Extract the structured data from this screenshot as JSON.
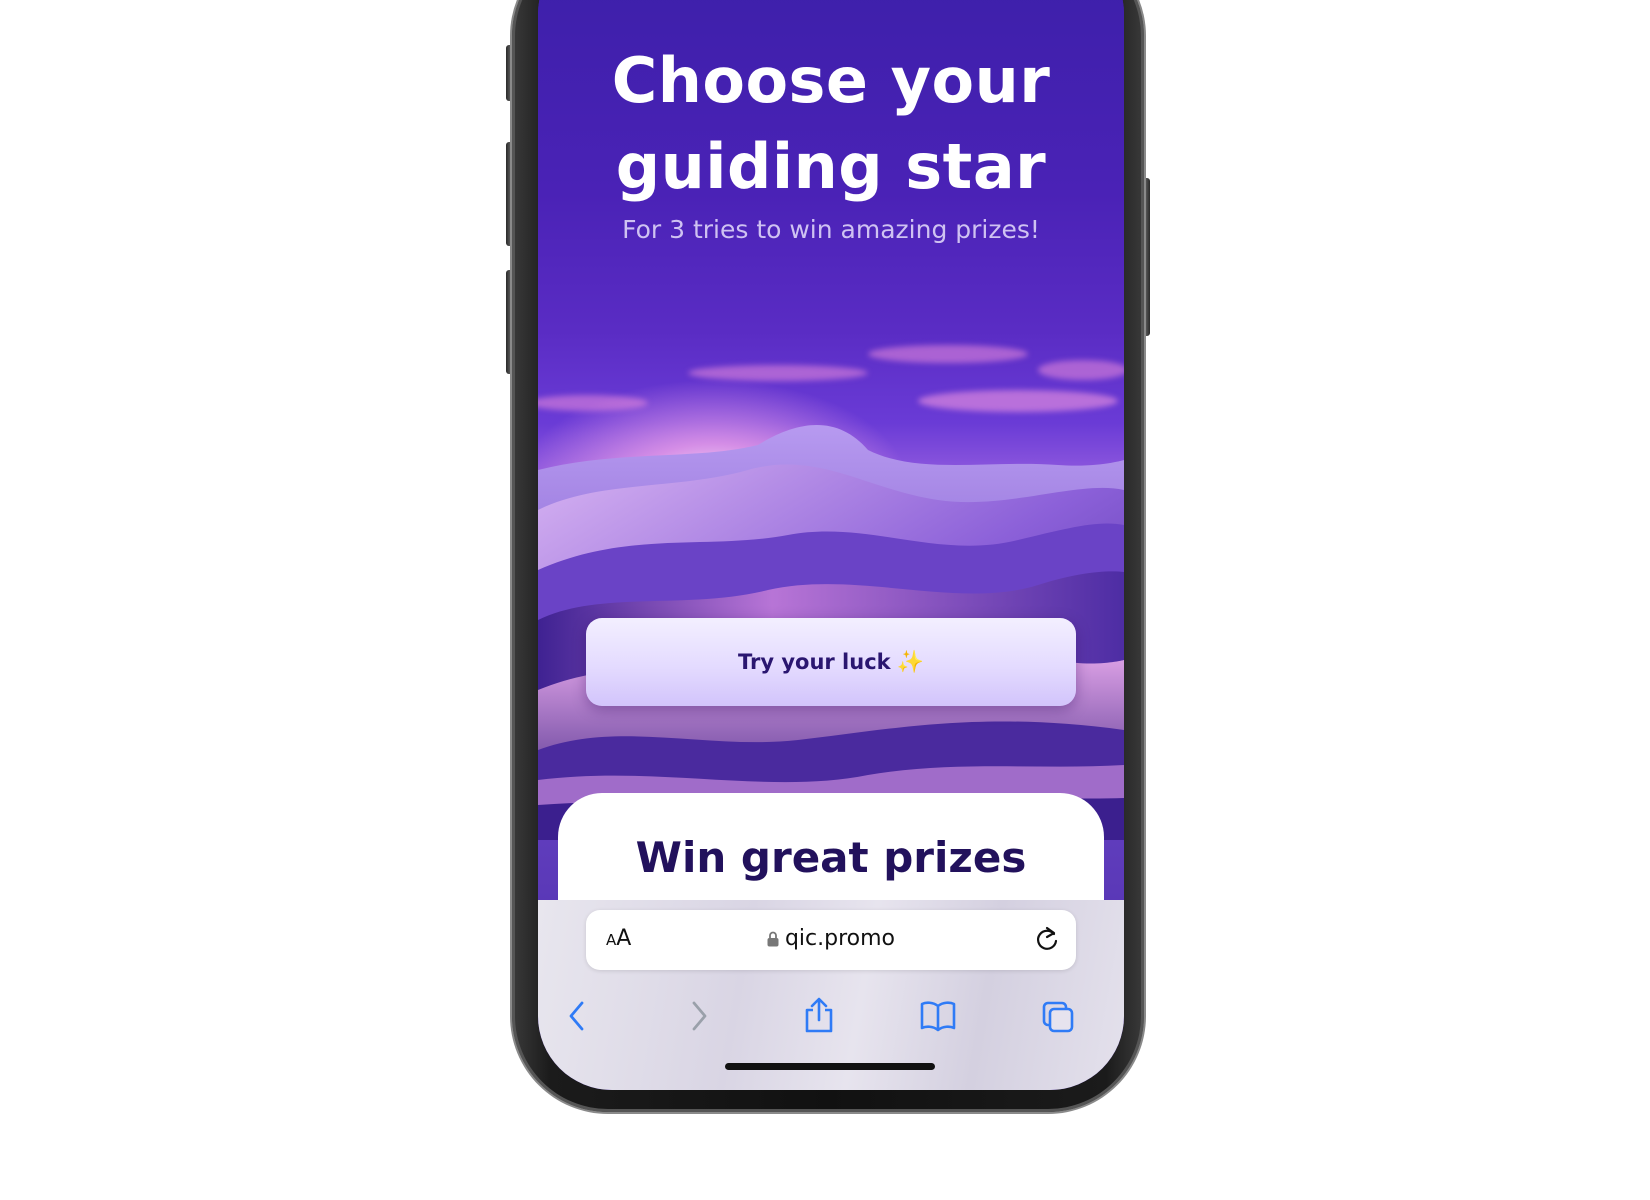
{
  "hero": {
    "title": "Choose your\nguiding star",
    "subtitle": "For 3 tries to win amazing prizes!"
  },
  "cta": {
    "label": "Try your luck",
    "emoji": "✨"
  },
  "card": {
    "title": "Win great prizes"
  },
  "browser": {
    "text_size_label_small": "A",
    "text_size_label_large": "A",
    "url": "qic.promo",
    "icons": [
      "lock-icon",
      "reload-icon",
      "back-icon",
      "forward-icon",
      "share-icon",
      "bookmarks-icon",
      "tabs-icon"
    ]
  },
  "colors": {
    "accent": "#2f7bf6",
    "forward_disabled": "#9aa0aa",
    "card_title": "#22115c",
    "cta_text": "#2a1670"
  }
}
